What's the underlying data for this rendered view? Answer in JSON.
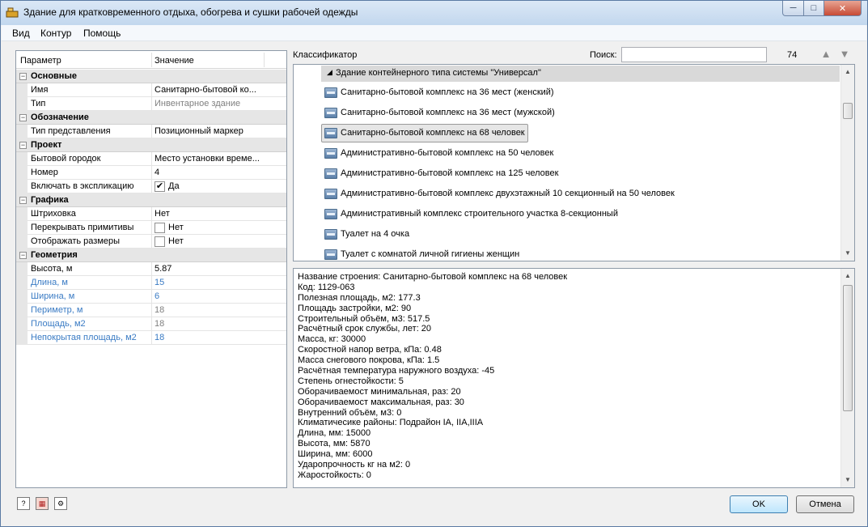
{
  "window": {
    "title": "Здание для кратковременного отдыха, обогрева и сушки рабочей одежды",
    "icons": [
      "app-icon",
      "minimize-icon",
      "maximize-icon",
      "close-icon"
    ]
  },
  "menu": [
    "Вид",
    "Контур",
    "Помощь"
  ],
  "property_grid": {
    "headers": {
      "param": "Параметр",
      "value": "Значение"
    },
    "categories": [
      {
        "label": "Основные",
        "rows": [
          {
            "name": "Имя",
            "value": "Санитарно-бытовой ко..."
          },
          {
            "name": "Тип",
            "value": "Инвентарное здание"
          }
        ]
      },
      {
        "label": "Обозначение",
        "rows": [
          {
            "name": "Тип представления",
            "value": "Позиционный маркер"
          }
        ]
      },
      {
        "label": "Проект",
        "rows": [
          {
            "name": "Бытовой городок",
            "value": "Место установки време..."
          },
          {
            "name": "Номер",
            "value": "4"
          },
          {
            "name": "Включать в экспликацию",
            "value": "Да",
            "checked": true
          }
        ]
      },
      {
        "label": "Графика",
        "rows": [
          {
            "name": "Штриховка",
            "value": "Нет"
          },
          {
            "name": "Перекрывать примитивы",
            "value": "Нет",
            "checked": false
          },
          {
            "name": "Отображать размеры",
            "value": "Нет",
            "checked": false
          }
        ]
      },
      {
        "label": "Геометрия",
        "rows": [
          {
            "name": "Высота, м",
            "value": "5.87"
          },
          {
            "name": "Длина, м",
            "value": "15"
          },
          {
            "name": "Ширина, м",
            "value": "6"
          },
          {
            "name": "Периметр, м",
            "value": "18"
          },
          {
            "name": "Площадь, м2",
            "value": "18"
          },
          {
            "name": "Непокрытая площадь, м2",
            "value": "18"
          }
        ]
      }
    ]
  },
  "classifier": {
    "label": "Классификатор",
    "search_label": "Поиск:",
    "search_value": "",
    "count": "74",
    "group": "Здание контейнерного типа системы \"Универсал\"",
    "items": [
      "Санитарно-бытовой комплекс на 36 мест (женский)",
      "Санитарно-бытовой комплекс на 36 мест (мужской)",
      "Санитарно-бытовой комплекс на 68 человек",
      "Административно-бытовой комплекс на 50 человек",
      "Административно-бытовой комплекс на 125 человек",
      "Административно-бытовой комплекс двухэтажный 10 секционный на 50 человек",
      "Административный комплекс строительного участка 8-секционный",
      "Туалет на 4 очка",
      "Туалет с комнатой личной гигиены женщин"
    ],
    "selected_index": 2
  },
  "details": [
    "Название строения: Санитарно-бытовой комплекс на 68 человек",
    "Код: 1129-063",
    "Полезная площадь, м2: 177.3",
    "Площадь застройки, м2: 90",
    "Строительный объём, м3: 517.5",
    "Расчётный срок службы, лет: 20",
    "Масса, кг: 30000",
    "Скоростной напор ветра, кПа: 0.48",
    "Масса снегового покрова, кПа: 1.5",
    "Расчётная температура наружного воздуха: -45",
    "Степень огнестойкости: 5",
    "Оборачиваемост минимальная, раз: 20",
    "Оборачиваемост максимальная, раз: 30",
    "Внутренний объём, м3: 0",
    "Климатичесике районы: Подрайон IA, IIA,IIIA",
    "Длина, мм: 15000",
    "Высота, мм: 5870",
    "Ширина, мм: 6000",
    "Ударопрочность кг на м2: 0",
    "Жаростойкость: 0"
  ],
  "buttons": {
    "ok": "OK",
    "cancel": "Отмена"
  }
}
